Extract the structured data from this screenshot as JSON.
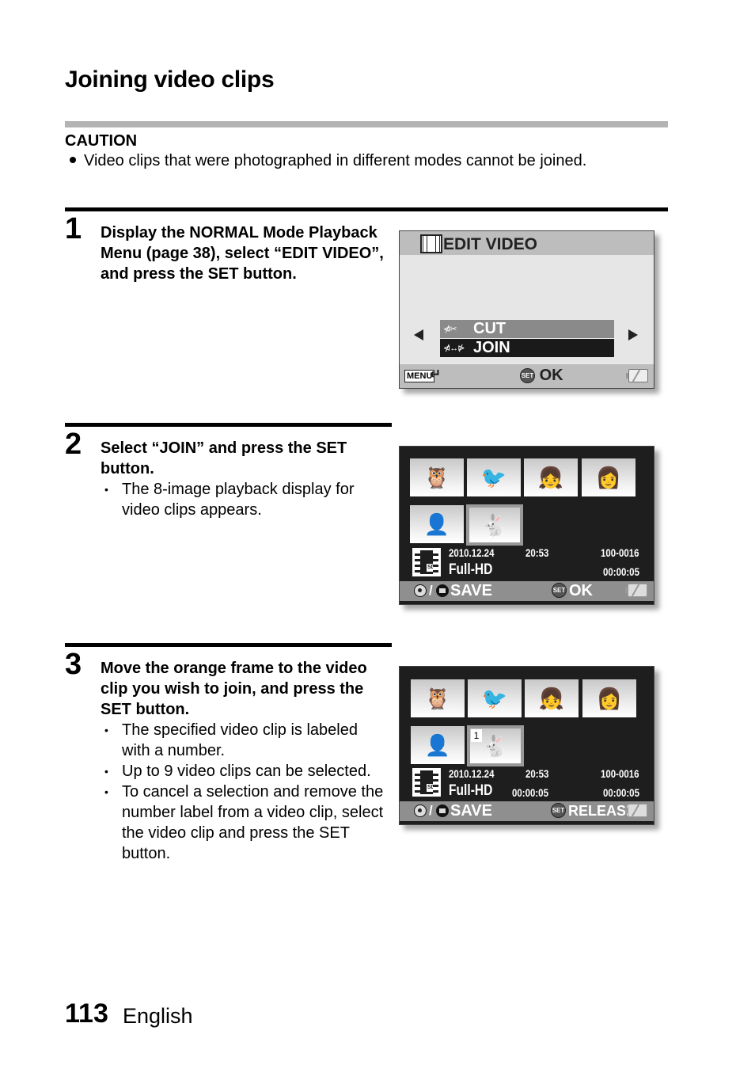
{
  "page": {
    "title": "Joining video clips",
    "page_number": "113",
    "language": "English"
  },
  "caution": {
    "title": "CAUTION",
    "text": "Video clips that were photographed in different modes cannot be joined."
  },
  "steps": [
    {
      "number": "1",
      "heading": "Display the NORMAL Mode Playback Menu (page 38), select “EDIT VIDEO”, and press the SET button.",
      "bullets": []
    },
    {
      "number": "2",
      "heading": "Select “JOIN” and press the SET button.",
      "bullets": [
        "The 8-image playback display for video clips appears."
      ]
    },
    {
      "number": "3",
      "heading": "Move the orange frame to the video clip you wish to join, and press the SET button.",
      "bullets": [
        "The specified video clip is labeled with a number.",
        "Up to 9 video clips can be selected.",
        "To cancel a selection and remove the number label from a video clip, select the video clip and press the SET button."
      ]
    }
  ],
  "screen1": {
    "title": "EDIT VIDEO",
    "title_icon": "film-edit-icon",
    "menu_items": [
      {
        "label": "CUT",
        "icon": "cut-clip-icon",
        "icon_glyph": "⋪✂",
        "state": "unselected"
      },
      {
        "label": "JOIN",
        "icon": "join-clip-icon",
        "icon_glyph": "⋪↔⋫",
        "state": "selected"
      }
    ],
    "footer": {
      "menu_label": "MENU",
      "return_glyph": "↵",
      "set_label": "SET",
      "ok_label": "OK"
    }
  },
  "thumbnails": [
    {
      "subject": "owl",
      "glyph": "🦉"
    },
    {
      "subject": "seagulls",
      "glyph": "🐦"
    },
    {
      "subject": "girl-with-dog",
      "glyph": "👧"
    },
    {
      "subject": "woman-portrait",
      "glyph": "👩"
    },
    {
      "subject": "woman-ponytail",
      "glyph": "👤"
    },
    {
      "subject": "rabbit",
      "glyph": "🐇"
    }
  ],
  "screen2": {
    "selected_index": 5,
    "info": {
      "date": "2010.12.24",
      "time": "20:53",
      "file_no": "100-0016",
      "quality": "Full-HD",
      "elapsed": "",
      "duration": "00:00:05",
      "media": "SD"
    },
    "bar": {
      "save_label": "SAVE",
      "set_label": "SET",
      "action_label": "OK"
    }
  },
  "screen3": {
    "selected_index": 5,
    "selection_number": "1",
    "info": {
      "date": "2010.12.24",
      "time": "20:53",
      "file_no": "100-0016",
      "quality": "Full-HD",
      "elapsed": "00:00:05",
      "duration": "00:00:05",
      "media": "SD"
    },
    "bar": {
      "save_label": "SAVE",
      "set_label": "SET",
      "action_label": "RELEASE"
    }
  },
  "colors": {
    "rule_gray": "#b3b3b3",
    "screen_dark": "#1e1e1e",
    "bar_gray": "#8f8f8f",
    "menu_selected": "#1a1a1a",
    "menu_unselected": "#8a8a8a"
  }
}
